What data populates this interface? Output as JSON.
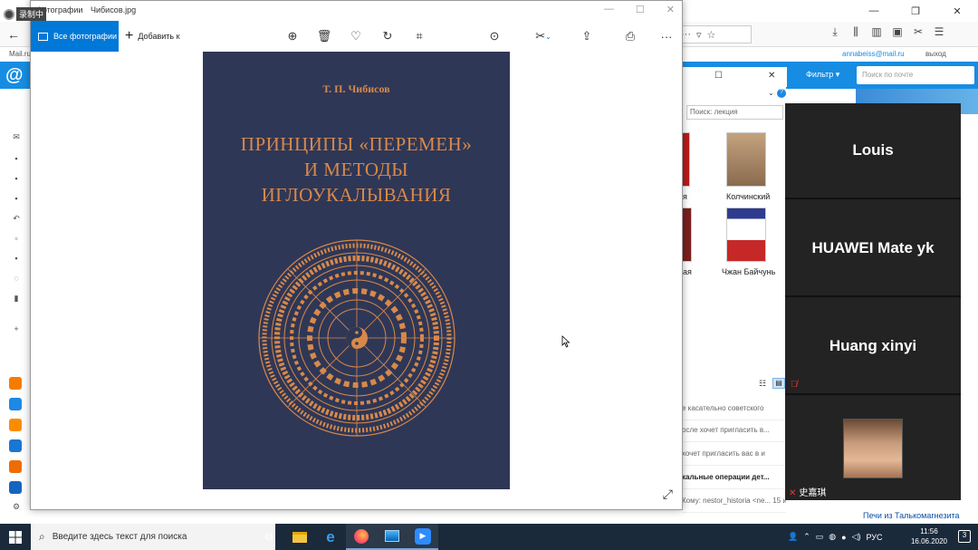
{
  "recording": {
    "label": "录制中"
  },
  "firefox": {
    "mail_user": "annabeiss@mail.ru",
    "mail_exit": "выход",
    "mail_logo_text": "Mail.ru",
    "filter_label": "Фильтр",
    "mail_search_placeholder": "Поиск по почте"
  },
  "explorer": {
    "search_placeholder": "Поиск: лекция",
    "books": [
      {
        "label": "я"
      },
      {
        "label": "Колчинский"
      },
      {
        "label": "ая"
      },
      {
        "label": "Чжан Байчунь"
      }
    ]
  },
  "mail_rows": [
    "е касательно советского",
    "осле хочет пригласить в...",
    "хочет пригласить вас в и",
    "кальные операции дет...",
    "Кому: nestor_historia <ne... 15 июн"
  ],
  "ads": {
    "title": "Печи из Талькомагнезита"
  },
  "zoom": {
    "participants": [
      {
        "name": "Louis"
      },
      {
        "name": "HUAWEI Mate yk"
      },
      {
        "name": "Huang xinyi"
      },
      {
        "name": "史嘉琪"
      }
    ]
  },
  "photos": {
    "app_name": "Фотографии",
    "file_name": "Чибисов.jpg",
    "all_photos_label": "Все фотографии",
    "add_label": "Добавить к",
    "book": {
      "author": "Т. П. Чибисов",
      "title_lines": [
        "ПРИНЦИПЫ «ПЕРЕМЕН»",
        "И МЕТОДЫ",
        "ИГЛОУКАЛЫВАНИЯ"
      ],
      "bg_color": "#2f3756",
      "accent_color": "#d8894a"
    }
  },
  "taskbar": {
    "search_placeholder": "Введите здесь текст для поиска",
    "lang": "РУС",
    "time": "11:56",
    "date": "16.06.2020",
    "notifications": "3"
  }
}
